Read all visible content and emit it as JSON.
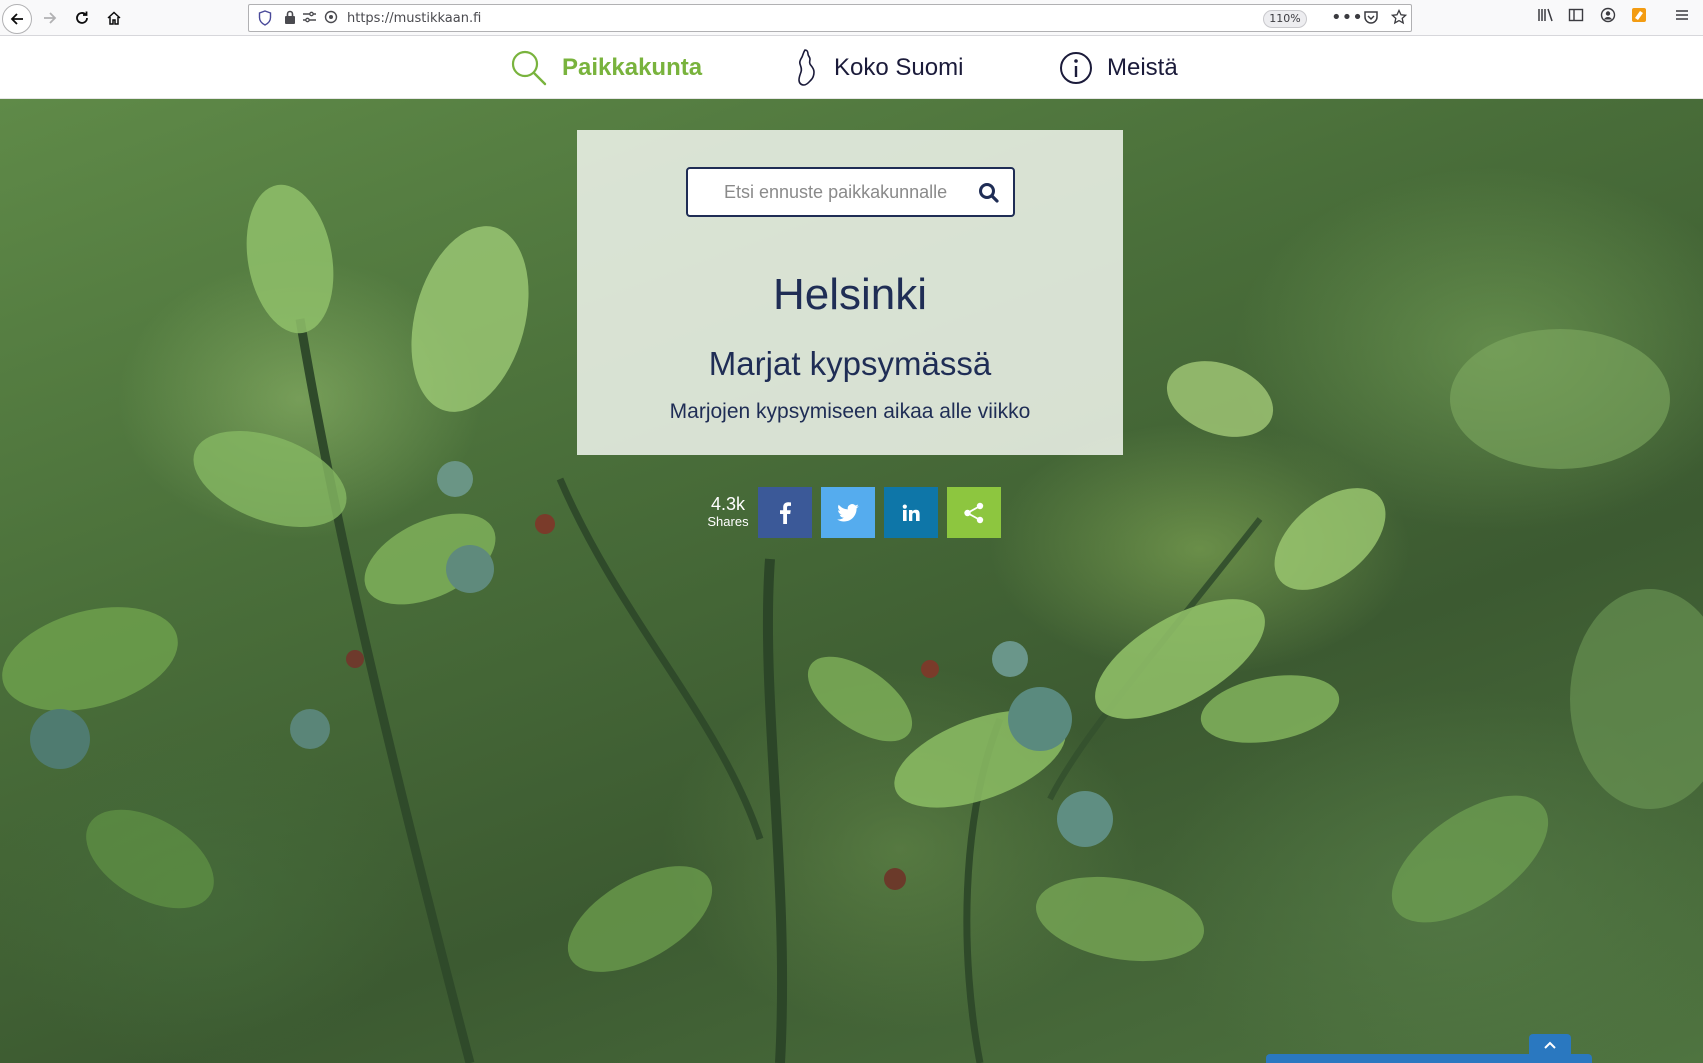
{
  "browser": {
    "url": "https://mustikkaan.fi",
    "zoom": "110%"
  },
  "nav": {
    "items": [
      {
        "label": "Paikkakunta",
        "icon": "search-icon",
        "active": true
      },
      {
        "label": "Koko Suomi",
        "icon": "finland-map-icon",
        "active": false
      },
      {
        "label": "Meistä",
        "icon": "info-icon",
        "active": false
      }
    ]
  },
  "search": {
    "placeholder": "Etsi ennuste paikkakunnalle"
  },
  "forecast": {
    "city": "Helsinki",
    "status": "Marjat kypsymässä",
    "detail": "Marjojen kypsymiseen aikaa alle viikko"
  },
  "share": {
    "count": "4.3k",
    "label": "Shares",
    "buttons": [
      {
        "network": "facebook",
        "icon": "facebook-icon",
        "color": "#3b5998"
      },
      {
        "network": "twitter",
        "icon": "twitter-icon",
        "color": "#55acee"
      },
      {
        "network": "linkedin",
        "icon": "linkedin-icon",
        "color": "#0e76a8"
      },
      {
        "network": "share",
        "icon": "share-icon",
        "color": "#8dc63f"
      }
    ]
  },
  "colors": {
    "accent": "#79b33d",
    "navy": "#1f2d55",
    "widget": "#2a78c0"
  }
}
